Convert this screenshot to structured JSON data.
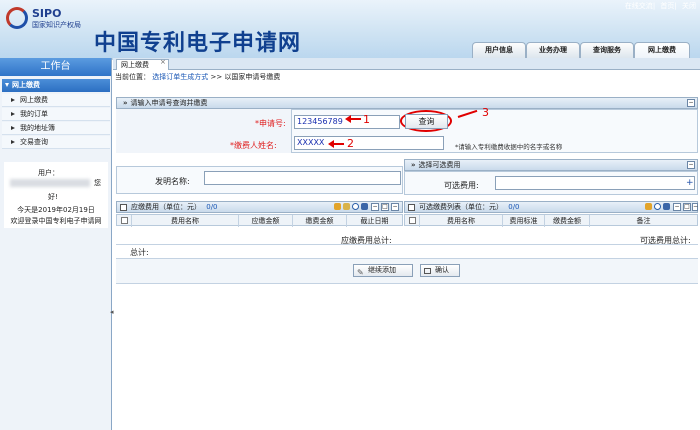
{
  "header": {
    "logo_text": "SIPO",
    "logo_sub": "国家知识产权局",
    "site_title": "中国专利电子申请网",
    "top_links": [
      "在线交流",
      "首页",
      "关闭"
    ],
    "nav_tabs": [
      {
        "label": "用户信息"
      },
      {
        "label": "业务办理"
      },
      {
        "label": "查询服务"
      },
      {
        "label": "网上缴费"
      }
    ]
  },
  "sidebar": {
    "title": "工作台",
    "section": "网上缴费",
    "items": [
      {
        "label": "网上缴费"
      },
      {
        "label": "我的订单"
      },
      {
        "label": "我的地址簿"
      },
      {
        "label": "交易查询"
      }
    ],
    "user_label": "用户：",
    "user_suffix": "您",
    "greeting": "好!",
    "date_text": "今天是2019年02月19日",
    "welcome": "欢迎登录中国专利电子申请网"
  },
  "main": {
    "tab_label": "网上缴费",
    "tab_close": "×",
    "breadcrumb_prefix": "当前位置：",
    "breadcrumb_link": "选择订单生成方式",
    "breadcrumb_sep": ">>",
    "breadcrumb_current": "以国家申请号缴费",
    "query_panel": {
      "title": "请输入申请号查询并缴费",
      "app_no_label": "*申请号:",
      "app_no_value": "123456789",
      "query_button": "查询",
      "payer_label": "*缴费人姓名:",
      "payer_value": "XXXXX",
      "hint": "*请输入专利缴费收据中的名字或名称"
    },
    "annotations": [
      "1",
      "2",
      "3"
    ],
    "invention_label": "发明名称:",
    "invention_value": "",
    "optional_panel": {
      "title": "选择可选费用",
      "fee_label": "可选费用:",
      "fee_value": ""
    },
    "due_fees": {
      "title": "应缴费用（单位：元）",
      "count": "0/0",
      "columns": [
        "费用名称",
        "应缴金额",
        "缴费金额",
        "截止日期"
      ],
      "total_label": "应缴费用总计:"
    },
    "optional_fees": {
      "title": "可选缴费列表（单位：元）",
      "count": "0/0",
      "columns": [
        "费用名称",
        "费用标准",
        "缴费金额",
        "备注"
      ],
      "total_label": "可选费用总计:"
    },
    "grand_total_label": "总计:",
    "buttons": {
      "continue": "继续添加",
      "confirm": "确认"
    }
  },
  "colors": {
    "accent_blue": "#2f74c8",
    "required_red": "#e02020",
    "annotation_red": "#e00000",
    "count_blue": "#1a57b5"
  }
}
